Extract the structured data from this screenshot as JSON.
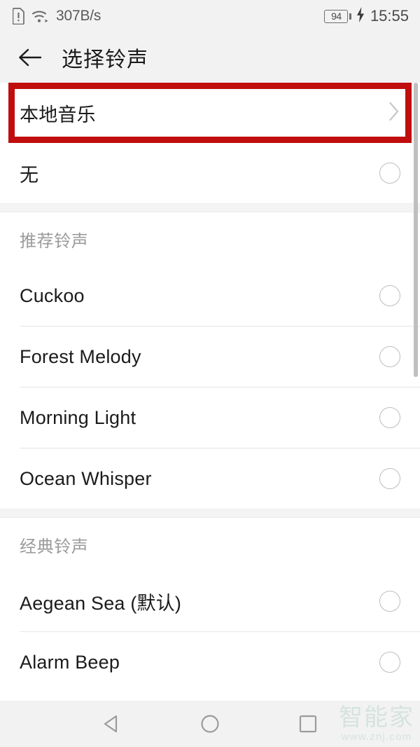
{
  "statusbar": {
    "sim_icon": "sim-alert-icon",
    "wifi_icon": "wifi-icon",
    "network_speed": "307B/s",
    "battery_level": "94",
    "battery_icon": "battery-charging-icon",
    "charging_icon": "lightning-bolt-icon",
    "time": "15:55"
  },
  "appbar": {
    "back_icon": "back-arrow-icon",
    "title": "选择铃声"
  },
  "list": [
    {
      "type": "item",
      "label": "本地音乐",
      "control": "chevron-right-icon",
      "highlighted": true
    },
    {
      "type": "item",
      "label": "无",
      "control": "radio-unselected",
      "selected": false
    },
    {
      "type": "gap"
    },
    {
      "type": "header",
      "label": "推荐铃声"
    },
    {
      "type": "item",
      "label": "Cuckoo",
      "control": "radio-unselected",
      "selected": false
    },
    {
      "type": "item",
      "label": "Forest Melody",
      "control": "radio-unselected",
      "selected": false
    },
    {
      "type": "item",
      "label": "Morning Light",
      "control": "radio-unselected",
      "selected": false
    },
    {
      "type": "item",
      "label": "Ocean Whisper",
      "control": "radio-unselected",
      "selected": false
    },
    {
      "type": "gap"
    },
    {
      "type": "header",
      "label": "经典铃声"
    },
    {
      "type": "item",
      "label": "Aegean Sea (默认)",
      "control": "radio-unselected",
      "selected": false
    },
    {
      "type": "item",
      "label": "Alarm Beep",
      "control": "radio-unselected",
      "selected": false
    }
  ],
  "navbar": {
    "back_icon": "nav-back-triangle-icon",
    "home_icon": "nav-home-circle-icon",
    "recents_icon": "nav-recents-square-icon"
  },
  "watermark": {
    "brand": "智能家",
    "url": "www.znj.com"
  },
  "colors": {
    "highlight_red": "#c00d0d",
    "bar_background": "#f2f2f2",
    "primary_text": "#1b1b1b",
    "secondary_text": "#9b9b9b",
    "divider": "#e6e6e6",
    "radio_outline": "#bdbdbd",
    "watermark": "#d6e3e0"
  },
  "scrollbar": {
    "name": "vertical-scrollbar"
  }
}
